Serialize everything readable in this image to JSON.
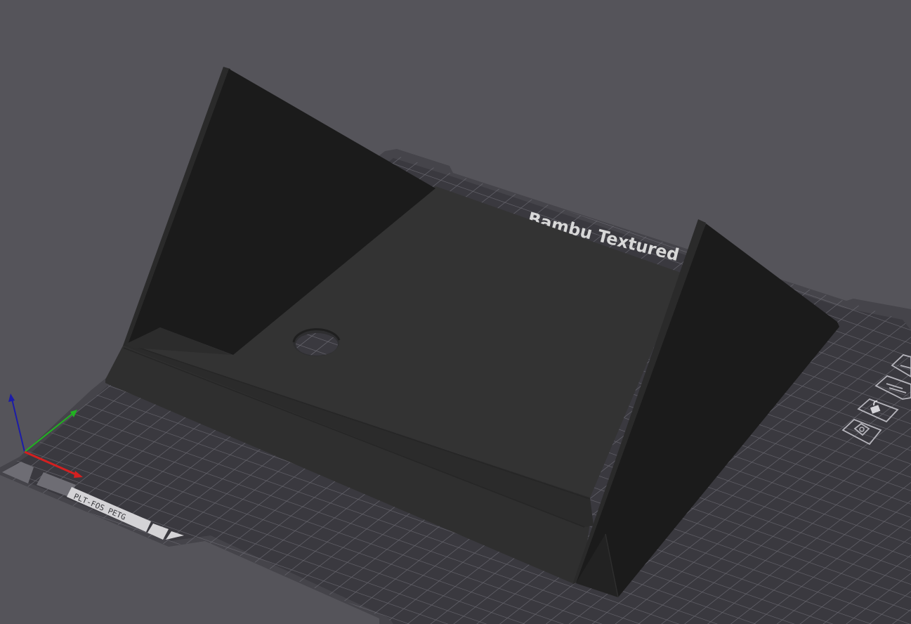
{
  "viewport": {
    "background_color": "#55545a"
  },
  "build_plate": {
    "label": "Bambu Textured PE",
    "filament_tag": "PLT-FOS PETG",
    "plate_color": "#3a393f",
    "grid_color": "#6b6a72",
    "rim_color": "#45444a"
  },
  "model": {
    "color_dark": "#1b1b1b",
    "color_face": "#2f2f2f",
    "color_mid": "#353535"
  },
  "axes": {
    "x_color": "#d42020",
    "y_color": "#21b321",
    "z_color": "#1c1ca8"
  },
  "plate_controls": [
    {
      "name": "plate-settings-icon",
      "label": "settings"
    },
    {
      "name": "plate-lock-icon",
      "label": "lock"
    },
    {
      "name": "plate-arrange-icon",
      "label": "arrange"
    },
    {
      "name": "plate-orient-icon",
      "label": "orient"
    }
  ]
}
